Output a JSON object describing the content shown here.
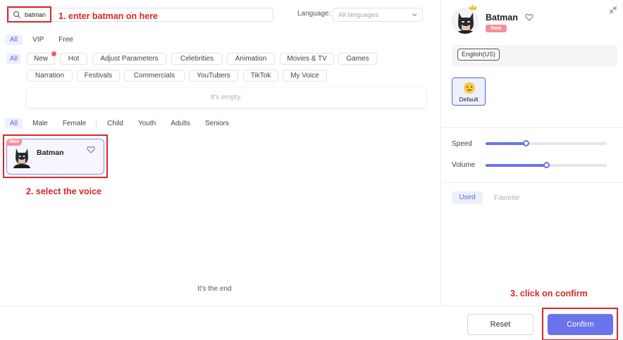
{
  "search": {
    "value": "batman"
  },
  "language": {
    "label": "Language:",
    "placeholder": "All languages"
  },
  "filters": {
    "price_tabs": [
      "All",
      "VIP",
      "Free"
    ],
    "category_all": "All",
    "categories": [
      "New",
      "Hot",
      "Adjust Parameters",
      "Celebrities",
      "Animation",
      "Movies & TV",
      "Games",
      "Narration",
      "Festivals",
      "Commercials",
      "YouTubers",
      "TikTok",
      "My Voice"
    ],
    "empty_text": "It's empty.",
    "demographic_tabs": [
      "All",
      "Male",
      "Female",
      "Child",
      "Youth",
      "Adults",
      "Seniors"
    ]
  },
  "voice_card": {
    "badge": "New",
    "name": "Batman"
  },
  "list_end": "It's the end",
  "annotations": {
    "step1": "1. enter batman on here",
    "step2": "2. select the voice",
    "step3": "3. click on confirm"
  },
  "detail": {
    "name": "Batman",
    "badge": "New",
    "language_chip": "English(US)",
    "style_label": "Default",
    "speed_label": "Speed",
    "speed_value": 0.33,
    "volume_label": "Volume",
    "volume_value": 0.5,
    "tabs": [
      "Used",
      "Favorite"
    ]
  },
  "footer": {
    "reset_label": "Reset",
    "confirm_label": "Confirm"
  },
  "colors": {
    "accent": "#6a73ec",
    "annotation": "#d7262b",
    "badge": "#f58f99"
  }
}
